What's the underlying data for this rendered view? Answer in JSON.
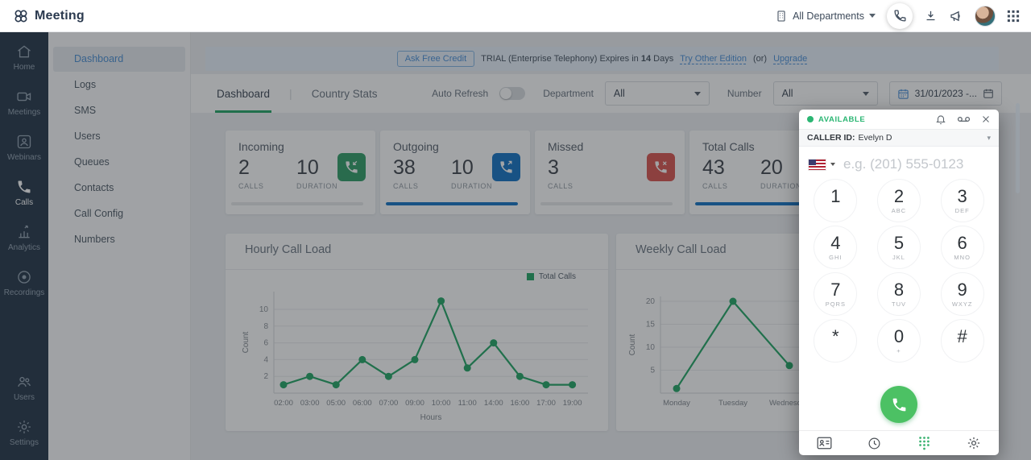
{
  "topbar": {
    "app_name": "Meeting",
    "department_selector": "All Departments"
  },
  "rail": {
    "active": "Calls",
    "items": [
      {
        "label": "Home"
      },
      {
        "label": "Meetings"
      },
      {
        "label": "Webinars"
      },
      {
        "label": "Calls"
      },
      {
        "label": "Analytics"
      },
      {
        "label": "Recordings"
      },
      {
        "label": "Users"
      },
      {
        "label": "Settings"
      }
    ]
  },
  "sidebar": {
    "active": "Dashboard",
    "items": [
      {
        "label": "Dashboard"
      },
      {
        "label": "Logs"
      },
      {
        "label": "SMS"
      },
      {
        "label": "Users"
      },
      {
        "label": "Queues"
      },
      {
        "label": "Contacts"
      },
      {
        "label": "Call Config"
      },
      {
        "label": "Numbers"
      }
    ]
  },
  "banner": {
    "credit_button": "Ask Free Credit",
    "trial_prefix": "TRIAL (Enterprise Telephony) Expires in",
    "trial_days": "14",
    "trial_suffix": "Days",
    "try_link": "Try Other Edition",
    "or_text": "(or)",
    "upgrade_link": "Upgrade"
  },
  "filters": {
    "tab_dashboard": "Dashboard",
    "tab_country_stats": "Country Stats",
    "active_tab": "Dashboard",
    "auto_refresh_label": "Auto Refresh",
    "auto_refresh_on": false,
    "department_label": "Department",
    "department_value": "All",
    "number_label": "Number",
    "number_value": "All",
    "date_range": "31/01/2023 -..."
  },
  "stats": [
    {
      "title": "Incoming",
      "calls": "2",
      "calls_label": "CALLS",
      "duration": "10",
      "duration_label": "DURATION",
      "color": "#2f9e67",
      "progress_pct": 0,
      "icon": "incoming-call-icon"
    },
    {
      "title": "Outgoing",
      "calls": "38",
      "calls_label": "CALLS",
      "duration": "10",
      "duration_label": "DURATION",
      "color": "#1273c5",
      "progress_pct": 100,
      "icon": "outgoing-call-icon"
    },
    {
      "title": "Missed",
      "calls": "3",
      "calls_label": "CALLS",
      "color": "#d9534f",
      "progress_pct": 0,
      "icon": "missed-call-icon"
    },
    {
      "title": "Total Calls",
      "calls": "43",
      "calls_label": "CALLS",
      "duration": "20",
      "duration_label": "DURATION",
      "color": "#1273c5",
      "progress_pct": 100,
      "icon": "total-calls-icon"
    }
  ],
  "chart_data": [
    {
      "type": "line",
      "title": "Hourly Call Load",
      "legend": "Total Calls",
      "legend_position": "top-right",
      "xlabel": "Hours",
      "ylabel": "Count",
      "grid": true,
      "color": "#21a565",
      "categories": [
        "02:00",
        "03:00",
        "05:00",
        "06:00",
        "07:00",
        "09:00",
        "10:00",
        "11:00",
        "14:00",
        "16:00",
        "17:00",
        "19:00"
      ],
      "values": [
        1,
        2,
        1,
        4,
        2,
        4,
        11,
        3,
        6,
        2,
        1,
        1
      ],
      "yticks": [
        2,
        4,
        6,
        8,
        10
      ],
      "ylim": [
        0,
        12
      ]
    },
    {
      "type": "line",
      "title": "Weekly Call Load",
      "xlabel": "",
      "ylabel": "Count",
      "grid": true,
      "color": "#21a565",
      "note": "partially hidden behind dialer panel",
      "categories": [
        "Monday",
        "Tuesday",
        "Wednesday"
      ],
      "values": [
        1,
        20,
        6
      ],
      "yticks": [
        5,
        10,
        15,
        20
      ],
      "ylim": [
        0,
        22
      ]
    }
  ],
  "dialer": {
    "status": "AVAILABLE",
    "status_color": "#2bb673",
    "caller_id_label": "CALLER ID:",
    "caller_id_value": "Evelyn D",
    "phone_placeholder": "e.g. (201) 555-0123",
    "call_button_color": "#4cc164",
    "keys": [
      {
        "digit": "1",
        "letters": ""
      },
      {
        "digit": "2",
        "letters": "ABC"
      },
      {
        "digit": "3",
        "letters": "DEF"
      },
      {
        "digit": "4",
        "letters": "GHI"
      },
      {
        "digit": "5",
        "letters": "JKL"
      },
      {
        "digit": "6",
        "letters": "MNO"
      },
      {
        "digit": "7",
        "letters": "PQRS"
      },
      {
        "digit": "8",
        "letters": "TUV"
      },
      {
        "digit": "9",
        "letters": "WXYZ"
      },
      {
        "digit": "*",
        "letters": ""
      },
      {
        "digit": "0",
        "letters": "+"
      },
      {
        "digit": "#",
        "letters": ""
      }
    ]
  }
}
